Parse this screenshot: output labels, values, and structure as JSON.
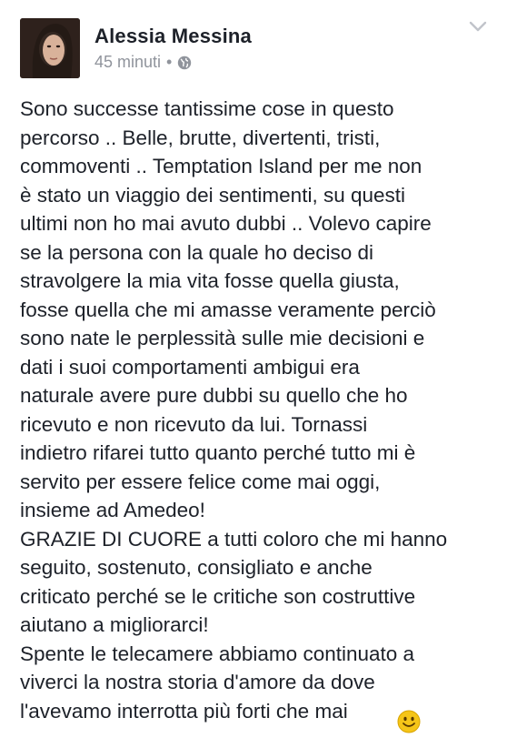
{
  "post": {
    "author": "Alessia Messina",
    "time": "45 minuti",
    "separator": "•",
    "privacy_icon": "globe-icon",
    "menu_icon": "chevron-down-icon",
    "text": "Sono successe tantissime cose in questo\npercorso .. Belle, brutte, divertenti, tristi,\ncommoventi .. Temptation Island per me non\nè stato un viaggio dei sentimenti, su questi\nultimi non ho mai avuto dubbi .. Volevo capire\nse la persona con la quale ho deciso di\nstravolgere la mia vita fosse quella giusta,\nfosse quella che mi amasse veramente perciò\nsono nate le perplessità sulle mie decisioni e\ndati i suoi comportamenti ambigui era\nnaturale avere pure dubbi su quello che ho\nricevuto e non ricevuto da lui. Tornassi\nindietro rifarei tutto quanto perché tutto mi è\nservito per essere felice come mai oggi,\ninsieme ad Amedeo!\nGRAZIE DI CUORE a tutti coloro che mi hanno\nseguito, sostenuto, consigliato e anche\ncriticato perché se le critiche son costruttive\naiutano a migliorarci!\nSpente le telecamere abbiamo continuato a\nviverci la nostra storia d'amore da dove\nl'avevamo interrotta più forti che mai",
    "emoji": "smiley-icon"
  },
  "colors": {
    "text": "#1d2129",
    "meta": "#90949c",
    "emoji": "#f5c518"
  }
}
